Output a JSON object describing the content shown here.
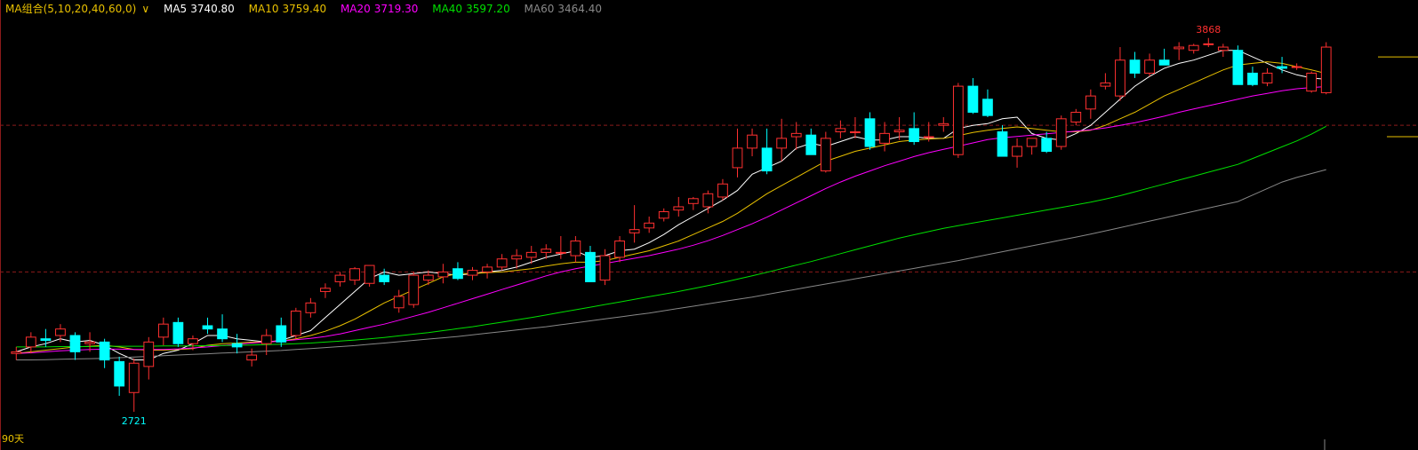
{
  "legend": {
    "combo_label": "MA组合(5,10,20,40,60,0)",
    "dropdown_glyph": "∨",
    "ma5": {
      "label": "MA5",
      "value": "3740.80",
      "color": "#ffffff"
    },
    "ma10": {
      "label": "MA10",
      "value": "3759.40",
      "color": "#e8c000"
    },
    "ma20": {
      "label": "MA20",
      "value": "3719.30",
      "color": "#ff00ff"
    },
    "ma40": {
      "label": "MA40",
      "value": "3597.20",
      "color": "#00e000"
    },
    "ma60": {
      "label": "MA60",
      "value": "3464.40",
      "color": "#888888"
    }
  },
  "range_label": "90天",
  "colors": {
    "background": "#000000",
    "up": "#ff3030",
    "down": "#00ffff",
    "grid": "#8b1a1a",
    "max_label": "#ff3030",
    "min_label": "#00ffff"
  },
  "chart_data": {
    "type": "candlestick",
    "days": 90,
    "ylim": [
      2650,
      3930
    ],
    "annotations": {
      "max": "3868",
      "min": "2721"
    },
    "ohlc": [
      [
        2900,
        2920,
        2880,
        2905
      ],
      [
        2920,
        2965,
        2900,
        2950
      ],
      [
        2945,
        2975,
        2920,
        2940
      ],
      [
        2955,
        2990,
        2935,
        2975
      ],
      [
        2955,
        2965,
        2880,
        2905
      ],
      [
        2930,
        2965,
        2905,
        2935
      ],
      [
        2935,
        2945,
        2855,
        2880
      ],
      [
        2875,
        2890,
        2770,
        2800
      ],
      [
        2780,
        2885,
        2721,
        2870
      ],
      [
        2860,
        2950,
        2820,
        2935
      ],
      [
        2950,
        3010,
        2925,
        2990
      ],
      [
        2995,
        3010,
        2920,
        2930
      ],
      [
        2930,
        2955,
        2910,
        2945
      ],
      [
        2985,
        3010,
        2960,
        2975
      ],
      [
        2975,
        3020,
        2935,
        2945
      ],
      [
        2930,
        2960,
        2900,
        2920
      ],
      [
        2880,
        2915,
        2860,
        2895
      ],
      [
        2930,
        2975,
        2895,
        2955
      ],
      [
        2985,
        3010,
        2920,
        2935
      ],
      [
        2955,
        3040,
        2945,
        3030
      ],
      [
        3025,
        3070,
        3010,
        3055
      ],
      [
        3090,
        3115,
        3070,
        3100
      ],
      [
        3120,
        3150,
        3105,
        3140
      ],
      [
        3125,
        3165,
        3110,
        3160
      ],
      [
        3115,
        3170,
        3105,
        3170
      ],
      [
        3140,
        3160,
        3110,
        3120
      ],
      [
        3040,
        3095,
        3025,
        3075
      ],
      [
        3050,
        3150,
        3040,
        3140
      ],
      [
        3125,
        3155,
        3110,
        3140
      ],
      [
        3135,
        3175,
        3115,
        3150
      ],
      [
        3160,
        3180,
        3125,
        3130
      ],
      [
        3140,
        3165,
        3125,
        3155
      ],
      [
        3150,
        3175,
        3130,
        3165
      ],
      [
        3165,
        3205,
        3155,
        3190
      ],
      [
        3190,
        3220,
        3160,
        3200
      ],
      [
        3195,
        3230,
        3175,
        3210
      ],
      [
        3210,
        3235,
        3190,
        3220
      ],
      [
        3210,
        3260,
        3190,
        3210
      ],
      [
        3200,
        3260,
        3180,
        3245
      ],
      [
        3210,
        3230,
        3120,
        3120
      ],
      [
        3125,
        3220,
        3110,
        3200
      ],
      [
        3195,
        3260,
        3180,
        3245
      ],
      [
        3270,
        3355,
        3240,
        3280
      ],
      [
        3285,
        3320,
        3270,
        3300
      ],
      [
        3315,
        3345,
        3305,
        3335
      ],
      [
        3340,
        3380,
        3320,
        3350
      ],
      [
        3360,
        3380,
        3340,
        3375
      ],
      [
        3350,
        3400,
        3330,
        3390
      ],
      [
        3380,
        3435,
        3370,
        3420
      ],
      [
        3470,
        3590,
        3440,
        3530
      ],
      [
        3530,
        3590,
        3505,
        3570
      ],
      [
        3530,
        3590,
        3450,
        3460
      ],
      [
        3530,
        3620,
        3490,
        3560
      ],
      [
        3565,
        3610,
        3525,
        3575
      ],
      [
        3570,
        3590,
        3510,
        3510
      ],
      [
        3460,
        3580,
        3455,
        3560
      ],
      [
        3580,
        3615,
        3560,
        3590
      ],
      [
        3580,
        3625,
        3560,
        3580
      ],
      [
        3620,
        3640,
        3525,
        3535
      ],
      [
        3545,
        3610,
        3520,
        3575
      ],
      [
        3580,
        3625,
        3555,
        3585
      ],
      [
        3590,
        3640,
        3540,
        3550
      ],
      [
        3565,
        3610,
        3550,
        3565
      ],
      [
        3600,
        3625,
        3580,
        3605
      ],
      [
        3510,
        3730,
        3500,
        3720
      ],
      [
        3720,
        3745,
        3635,
        3640
      ],
      [
        3680,
        3710,
        3625,
        3630
      ],
      [
        3580,
        3600,
        3505,
        3505
      ],
      [
        3505,
        3560,
        3470,
        3535
      ],
      [
        3535,
        3560,
        3510,
        3560
      ],
      [
        3560,
        3580,
        3515,
        3520
      ],
      [
        3535,
        3630,
        3525,
        3620
      ],
      [
        3610,
        3650,
        3600,
        3640
      ],
      [
        3650,
        3710,
        3620,
        3690
      ],
      [
        3720,
        3760,
        3710,
        3730
      ],
      [
        3690,
        3840,
        3675,
        3800
      ],
      [
        3800,
        3825,
        3745,
        3760
      ],
      [
        3760,
        3820,
        3750,
        3800
      ],
      [
        3800,
        3835,
        3785,
        3785
      ],
      [
        3835,
        3855,
        3800,
        3840
      ],
      [
        3830,
        3850,
        3820,
        3845
      ],
      [
        3850,
        3868,
        3840,
        3850
      ],
      [
        3830,
        3850,
        3810,
        3840
      ],
      [
        3830,
        3845,
        3725,
        3725
      ],
      [
        3760,
        3780,
        3720,
        3725
      ],
      [
        3730,
        3775,
        3720,
        3760
      ],
      [
        3780,
        3810,
        3760,
        3775
      ],
      [
        3780,
        3790,
        3770,
        3780
      ],
      [
        3705,
        3765,
        3700,
        3760
      ],
      [
        3700,
        3855,
        3695,
        3840
      ]
    ],
    "series": [
      {
        "name": "MA5",
        "color": "#ffffff",
        "values": [
          2905,
          2920,
          2930,
          2945,
          2935,
          2940,
          2925,
          2900,
          2880,
          2880,
          2900,
          2910,
          2930,
          2955,
          2955,
          2945,
          2940,
          2935,
          2940,
          2955,
          2970,
          3010,
          3050,
          3090,
          3130,
          3150,
          3140,
          3145,
          3150,
          3145,
          3140,
          3145,
          3150,
          3155,
          3165,
          3180,
          3195,
          3205,
          3215,
          3195,
          3200,
          3215,
          3220,
          3240,
          3265,
          3295,
          3320,
          3345,
          3370,
          3400,
          3450,
          3470,
          3490,
          3530,
          3545,
          3535,
          3550,
          3565,
          3555,
          3555,
          3565,
          3565,
          3560,
          3560,
          3590,
          3600,
          3605,
          3620,
          3625,
          3575,
          3560,
          3555,
          3575,
          3600,
          3640,
          3680,
          3720,
          3750,
          3775,
          3790,
          3800,
          3815,
          3830,
          3830,
          3810,
          3790,
          3770,
          3755,
          3745,
          3741
        ]
      },
      {
        "name": "MA10",
        "color": "#e8c000",
        "values": [
          2900,
          2905,
          2910,
          2915,
          2920,
          2922,
          2925,
          2920,
          2912,
          2910,
          2910,
          2912,
          2915,
          2925,
          2930,
          2932,
          2935,
          2935,
          2938,
          2945,
          2955,
          2968,
          2985,
          3005,
          3030,
          3055,
          3075,
          3095,
          3115,
          3135,
          3145,
          3145,
          3148,
          3150,
          3155,
          3160,
          3168,
          3175,
          3180,
          3180,
          3185,
          3195,
          3205,
          3215,
          3230,
          3245,
          3265,
          3285,
          3305,
          3330,
          3360,
          3390,
          3415,
          3440,
          3465,
          3490,
          3505,
          3520,
          3530,
          3540,
          3550,
          3555,
          3558,
          3560,
          3568,
          3578,
          3585,
          3590,
          3595,
          3590,
          3585,
          3580,
          3580,
          3585,
          3600,
          3620,
          3640,
          3665,
          3690,
          3710,
          3730,
          3750,
          3770,
          3785,
          3790,
          3795,
          3790,
          3780,
          3770,
          3759
        ]
      },
      {
        "name": "MA20",
        "color": "#ff00ff",
        "values": [
          2900,
          2902,
          2905,
          2908,
          2910,
          2912,
          2913,
          2913,
          2912,
          2912,
          2912,
          2914,
          2917,
          2920,
          2924,
          2928,
          2932,
          2935,
          2938,
          2942,
          2946,
          2952,
          2960,
          2970,
          2980,
          2990,
          3002,
          3014,
          3026,
          3040,
          3054,
          3068,
          3082,
          3096,
          3110,
          3124,
          3138,
          3150,
          3160,
          3168,
          3176,
          3184,
          3192,
          3200,
          3210,
          3220,
          3232,
          3246,
          3262,
          3280,
          3298,
          3318,
          3340,
          3362,
          3384,
          3406,
          3426,
          3444,
          3460,
          3476,
          3490,
          3504,
          3516,
          3526,
          3536,
          3546,
          3556,
          3562,
          3566,
          3570,
          3574,
          3578,
          3582,
          3586,
          3592,
          3600,
          3608,
          3618,
          3628,
          3640,
          3650,
          3660,
          3670,
          3680,
          3690,
          3698,
          3706,
          3712,
          3716,
          3719
        ]
      },
      {
        "name": "MA40",
        "color": "#00e000",
        "values": [
          2920,
          2920,
          2920,
          2921,
          2921,
          2921,
          2922,
          2922,
          2922,
          2922,
          2923,
          2923,
          2923,
          2924,
          2924,
          2925,
          2926,
          2927,
          2928,
          2930,
          2932,
          2935,
          2938,
          2941,
          2945,
          2949,
          2954,
          2959,
          2964,
          2970,
          2976,
          2982,
          2989,
          2996,
          3003,
          3010,
          3018,
          3026,
          3034,
          3042,
          3050,
          3058,
          3066,
          3074,
          3082,
          3090,
          3099,
          3108,
          3118,
          3128,
          3138,
          3149,
          3160,
          3171,
          3182,
          3194,
          3206,
          3218,
          3230,
          3242,
          3254,
          3264,
          3274,
          3284,
          3292,
          3300,
          3308,
          3316,
          3324,
          3332,
          3340,
          3348,
          3356,
          3364,
          3374,
          3384,
          3396,
          3408,
          3420,
          3432,
          3444,
          3456,
          3468,
          3480,
          3498,
          3516,
          3534,
          3552,
          3573,
          3597
        ]
      },
      {
        "name": "MA60",
        "color": "#888888",
        "values": [
          2880,
          2880,
          2881,
          2882,
          2883,
          2884,
          2885,
          2887,
          2889,
          2891,
          2893,
          2895,
          2897,
          2899,
          2901,
          2903,
          2905,
          2907,
          2909,
          2912,
          2915,
          2918,
          2921,
          2924,
          2928,
          2932,
          2936,
          2940,
          2944,
          2948,
          2952,
          2957,
          2962,
          2967,
          2972,
          2977,
          2982,
          2988,
          2994,
          3000,
          3006,
          3012,
          3018,
          3024,
          3031,
          3038,
          3045,
          3052,
          3059,
          3066,
          3073,
          3081,
          3089,
          3097,
          3105,
          3113,
          3121,
          3129,
          3137,
          3145,
          3153,
          3161,
          3169,
          3177,
          3185,
          3194,
          3203,
          3212,
          3221,
          3230,
          3239,
          3248,
          3257,
          3266,
          3276,
          3286,
          3296,
          3306,
          3316,
          3326,
          3336,
          3346,
          3356,
          3366,
          3386,
          3406,
          3426,
          3440,
          3452,
          3464
        ]
      }
    ]
  }
}
